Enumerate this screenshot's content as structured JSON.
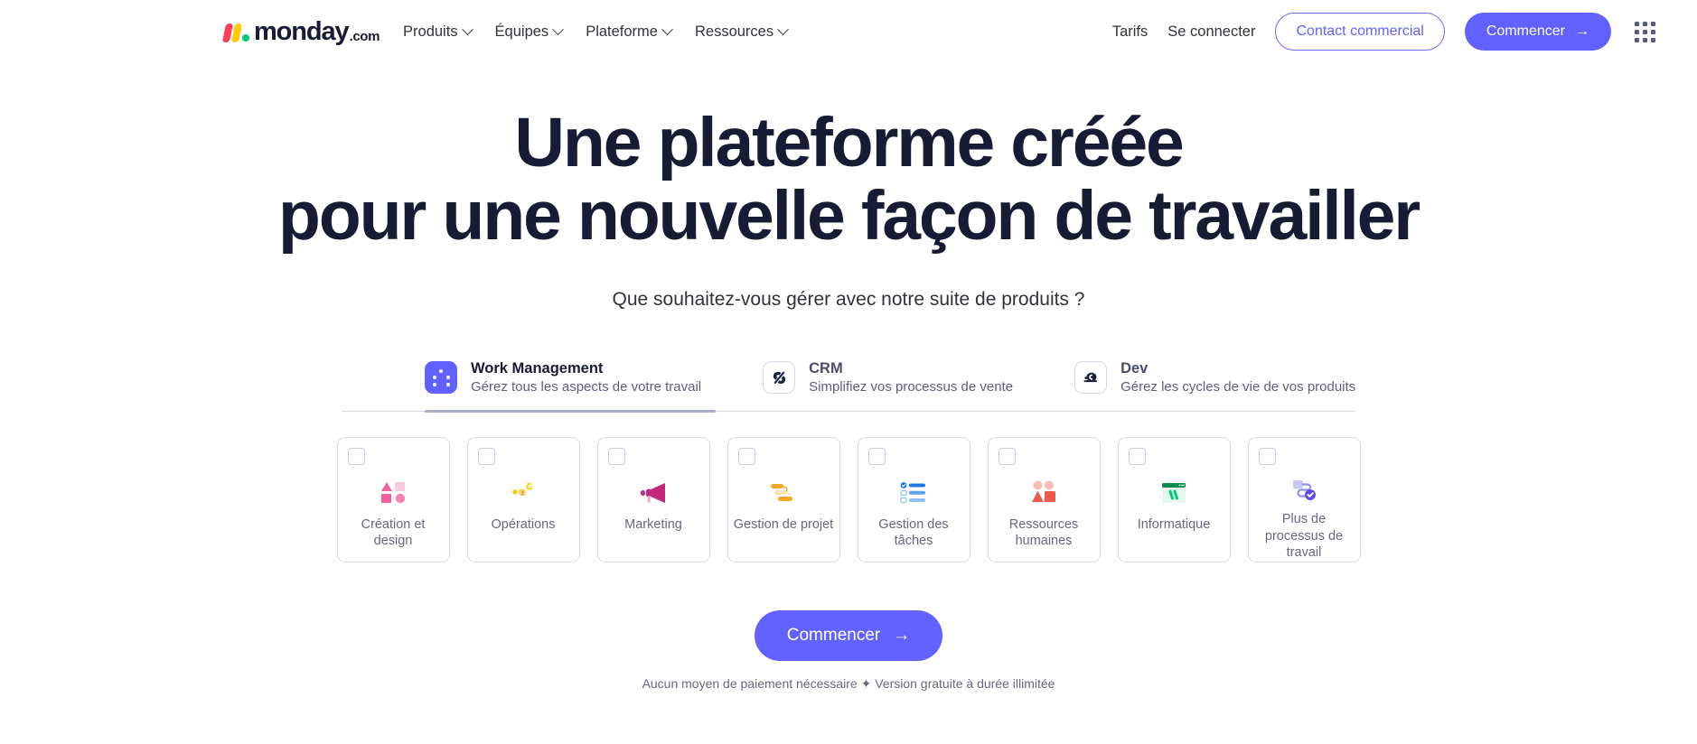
{
  "brand": {
    "logo_word": "monday",
    "logo_tld": ".com",
    "accent": "#6161ff",
    "logo_pink": "#ff3d57",
    "logo_yellow": "#ffcb00",
    "logo_green": "#00ca72"
  },
  "nav": {
    "links": [
      {
        "label": "Produits",
        "icon": "chevron-down-icon"
      },
      {
        "label": "Équipes",
        "icon": "chevron-down-icon"
      },
      {
        "label": "Plateforme",
        "icon": "chevron-down-icon"
      },
      {
        "label": "Ressources",
        "icon": "chevron-down-icon"
      }
    ],
    "pricing": "Tarifs",
    "login": "Se connecter",
    "contact_sales": "Contact commercial",
    "get_started": "Commencer",
    "get_started_arrow": "→",
    "apps_icon": "grid-apps-icon"
  },
  "hero": {
    "headline_line1": "Une plateforme créée",
    "headline_line2": "pour une nouvelle façon de travailler",
    "subhead": "Que souhaitez-vous gérer avec notre suite de produits ?"
  },
  "tabs": [
    {
      "title": "Work Management",
      "subtitle": "Gérez tous les aspects de votre travail",
      "icon": "work-management-dots-icon",
      "active": true
    },
    {
      "title": "CRM",
      "subtitle": "Simplifiez vos processus de vente",
      "icon": "crm-loop-icon",
      "active": false
    },
    {
      "title": "Dev",
      "subtitle": "Gérez les cycles de vie de vos produits",
      "icon": "dev-icon",
      "active": false
    }
  ],
  "cards": [
    {
      "label": "Création et design",
      "icon": "shapes-pink-icon",
      "checked": false
    },
    {
      "label": "Opérations",
      "icon": "gears-yellow-icon",
      "checked": false
    },
    {
      "label": "Marketing",
      "icon": "megaphone-icon",
      "checked": false
    },
    {
      "label": "Gestion de projet",
      "icon": "gantt-orange-icon",
      "checked": false
    },
    {
      "label": "Gestion  des tâches",
      "icon": "checklist-blue-icon",
      "checked": false
    },
    {
      "label": "Ressources humaines",
      "icon": "people-red-icon",
      "checked": false
    },
    {
      "label": "Informatique",
      "icon": "browser-green-icon",
      "checked": false
    },
    {
      "label": "Plus de processus de travail",
      "icon": "workflow-purple-icon",
      "checked": false
    }
  ],
  "cta": {
    "label": "Commencer",
    "arrow": "→",
    "disclaimer": "Aucun moyen de paiement nécessaire ✦ Version gratuite à durée illimitée"
  }
}
